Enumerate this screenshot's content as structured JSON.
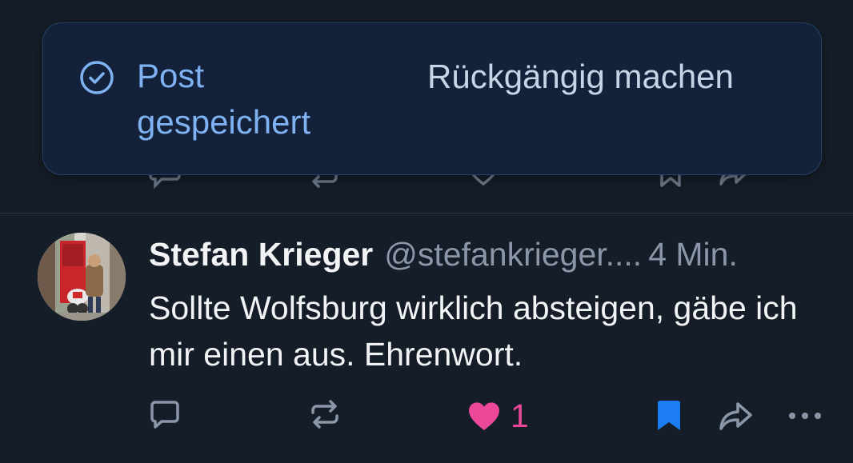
{
  "toast": {
    "icon": "check-circle-icon",
    "message": "Post gespeichert",
    "undo_label": "Rückgängig machen"
  },
  "post": {
    "author_name": "Stefan Krieger",
    "handle": "@stefankrieger....",
    "time": "4 Min.",
    "text": "Sollte Wolfsburg wirklich absteigen, gäbe ich mir einen aus. Ehrenwort.",
    "like_count": "1",
    "liked": true,
    "bookmarked": true,
    "actions": [
      "reply-icon",
      "repost-icon",
      "heart-icon",
      "bookmark-icon",
      "share-icon",
      "more-icon"
    ]
  },
  "colors": {
    "background": "#151d28",
    "toast_bg": "#13213a",
    "toast_text": "#7fb2f3",
    "like": "#ec4899",
    "bookmark": "#1d7cf2",
    "muted": "#8b97a8"
  }
}
